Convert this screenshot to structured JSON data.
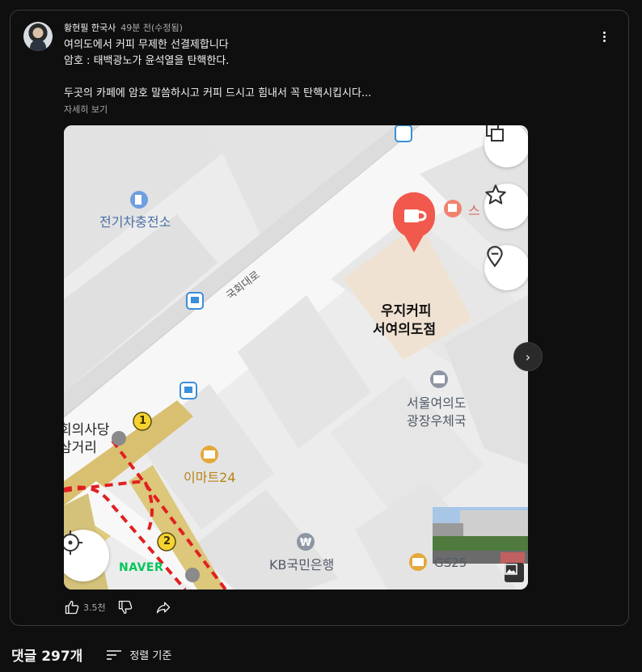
{
  "post": {
    "author": "황현필 한국사",
    "time": "49분 전(수정됨)",
    "line1": "여의도에서 커피 무제한 선결제합니다",
    "line2": "암호 : 태백광노가 윤석열을 탄핵한다.",
    "line3": "두곳의 카페에 암호 말씀하시고 커피 드시고 힘내서 꼭 탄핵시킵시다...",
    "read_more": "자세히 보기"
  },
  "map": {
    "labels": {
      "ev_station": "전기차충전소",
      "road": "국회대로",
      "cafe_name": "우지커피",
      "cafe_branch": "서여의도점",
      "post_office_1": "서울여의도",
      "post_office_2": "광장우체국",
      "emart": "이마트24",
      "bank": "KB국민은행",
      "crossroad_1": "회의사당",
      "crossroad_2": "삼거리",
      "partial_right": "스",
      "gs": "GS25",
      "naver": "NAVER",
      "exit1": "1",
      "exit2": "2"
    },
    "icons": [
      "copy-icon",
      "star-icon",
      "location-pin-icon",
      "crosshair-icon",
      "image-icon"
    ]
  },
  "actions": {
    "like_count": "3.5천"
  },
  "comments": {
    "title": "댓글 297개",
    "sort_label": "정렬 기준"
  },
  "colors": {
    "background": "#0f0f0f",
    "cafe_pin": "#f0594c",
    "naver_green": "#03c75a",
    "route_red": "#e02020",
    "subway_yellow": "#f5d331"
  }
}
